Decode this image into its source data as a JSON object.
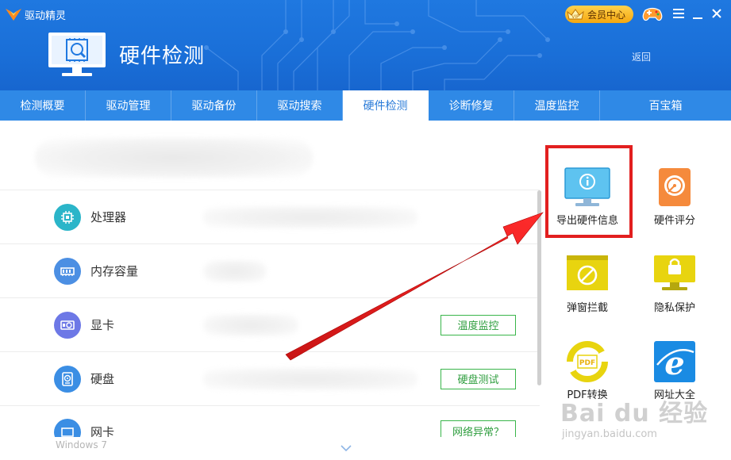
{
  "app": {
    "title": "驱动精灵"
  },
  "header": {
    "page_title": "硬件检测",
    "back_label": "返回",
    "vip_badge": "VIP",
    "vip_label": "会员中心"
  },
  "tabs": [
    {
      "label": "检测概要"
    },
    {
      "label": "驱动管理"
    },
    {
      "label": "驱动备份"
    },
    {
      "label": "驱动搜索"
    },
    {
      "label": "硬件检测",
      "active": true
    },
    {
      "label": "诊断修复"
    },
    {
      "label": "温度监控"
    },
    {
      "label": "百宝箱"
    }
  ],
  "hardware": [
    {
      "label": "处理器",
      "icon": "cpu-icon",
      "button": ""
    },
    {
      "label": "内存容量",
      "icon": "memory-icon",
      "button": ""
    },
    {
      "label": "显卡",
      "icon": "gpu-icon",
      "button": "温度监控"
    },
    {
      "label": "硬盘",
      "icon": "disk-icon",
      "button": "硬盘测试"
    },
    {
      "label": "网卡",
      "icon": "network-icon",
      "button": "网络异常？"
    }
  ],
  "tools": [
    {
      "label": "导出硬件信息",
      "icon": "info-monitor-icon"
    },
    {
      "label": "硬件评分",
      "icon": "hdd-score-icon"
    },
    {
      "label": "弹窗拦截",
      "icon": "block-popup-icon"
    },
    {
      "label": "隐私保护",
      "icon": "privacy-lock-icon"
    },
    {
      "label": "PDF转换",
      "icon": "pdf-convert-icon"
    },
    {
      "label": "网址大全",
      "icon": "ie-icon"
    }
  ],
  "footer": {
    "os_label": "Windows 7"
  },
  "watermark": {
    "brand": "Bai du 经验",
    "url": "jingyan.baidu.com"
  },
  "colors": {
    "header_blue": "#1f78e0",
    "tab_blue": "#2f89e6",
    "accent_green": "#39b54a",
    "highlight_red": "#e21f1f"
  }
}
